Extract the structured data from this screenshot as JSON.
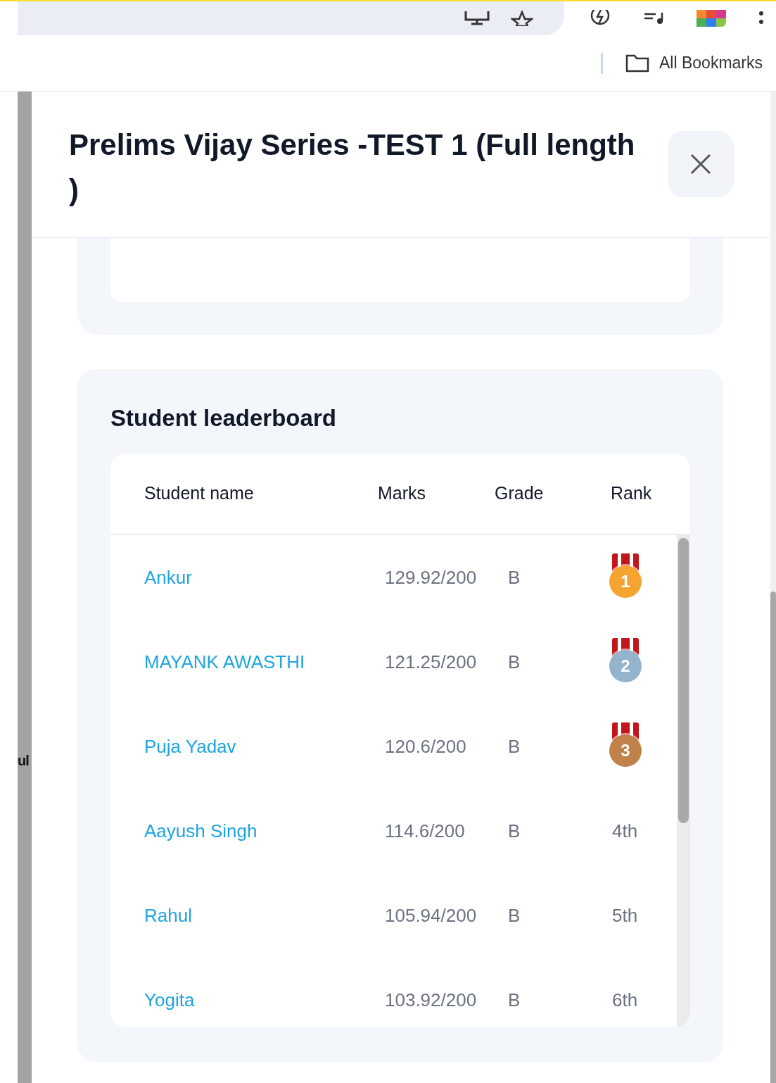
{
  "browser": {
    "bookmarks_label": "All Bookmarks"
  },
  "background_fragment": "ul",
  "modal": {
    "title": "Prelims Vijay Series -TEST 1 (Full length )",
    "leaderboard": {
      "title": "Student leaderboard",
      "columns": [
        "Student name",
        "Marks",
        "Grade",
        "Rank"
      ],
      "rows": [
        {
          "name": "Ankur",
          "marks": "129.92/200",
          "grade": "B",
          "rank": "1",
          "kind": "medal",
          "color": "#f5a431"
        },
        {
          "name": "MAYANK AWASTHI",
          "marks": "121.25/200",
          "grade": "B",
          "rank": "2",
          "kind": "medal",
          "color": "#94b3cc"
        },
        {
          "name": "Puja Yadav",
          "marks": "120.6/200",
          "grade": "B",
          "rank": "3",
          "kind": "medal",
          "color": "#c0824a"
        },
        {
          "name": "Aayush Singh",
          "marks": "114.6/200",
          "grade": "B",
          "rank": "4th",
          "kind": "text"
        },
        {
          "name": "Rahul",
          "marks": "105.94/200",
          "grade": "B",
          "rank": "5th",
          "kind": "text"
        },
        {
          "name": "Yogita",
          "marks": "103.92/200",
          "grade": "B",
          "rank": "6th",
          "kind": "text"
        }
      ]
    }
  }
}
